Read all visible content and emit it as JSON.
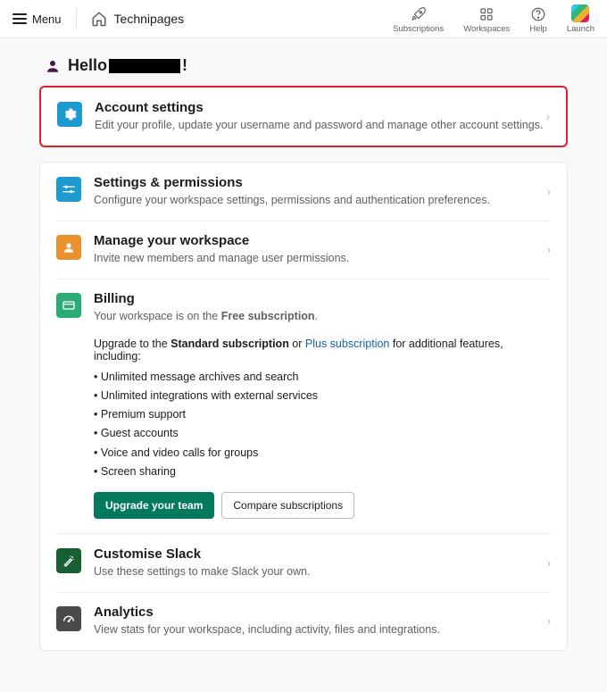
{
  "topbar": {
    "menu": "Menu",
    "workspace": "Technipages",
    "nav": {
      "subs": "Subscriptions",
      "workspaces": "Workspaces",
      "help": "Help",
      "launch": "Launch"
    }
  },
  "greeting": {
    "hello": "Hello",
    "punct": "!"
  },
  "account": {
    "title": "Account settings",
    "desc": "Edit your profile, update your username and password and manage other account settings."
  },
  "settings": {
    "title": "Settings & permissions",
    "desc": "Configure your workspace settings, permissions and authentication preferences."
  },
  "manage": {
    "title": "Manage your workspace",
    "desc": "Invite new members and manage user permissions."
  },
  "billing": {
    "title": "Billing",
    "desc_pre": "Your workspace is on the ",
    "desc_bold": "Free subscription",
    "desc_post": ".",
    "upgrade_pre": "Upgrade to the ",
    "upgrade_std": "Standard subscription",
    "upgrade_or": " or ",
    "upgrade_plus": "Plus subscription",
    "upgrade_post": " for additional features, including:",
    "features": [
      "Unlimited message archives and search",
      "Unlimited integrations with external services",
      "Premium support",
      "Guest accounts",
      "Voice and video calls for groups",
      "Screen sharing"
    ],
    "btn_upgrade": "Upgrade your team",
    "btn_compare": "Compare subscriptions"
  },
  "custom": {
    "title": "Customise Slack",
    "desc": "Use these settings to make Slack your own."
  },
  "analytics": {
    "title": "Analytics",
    "desc": "View stats for your workspace, including activity, files and integrations."
  }
}
